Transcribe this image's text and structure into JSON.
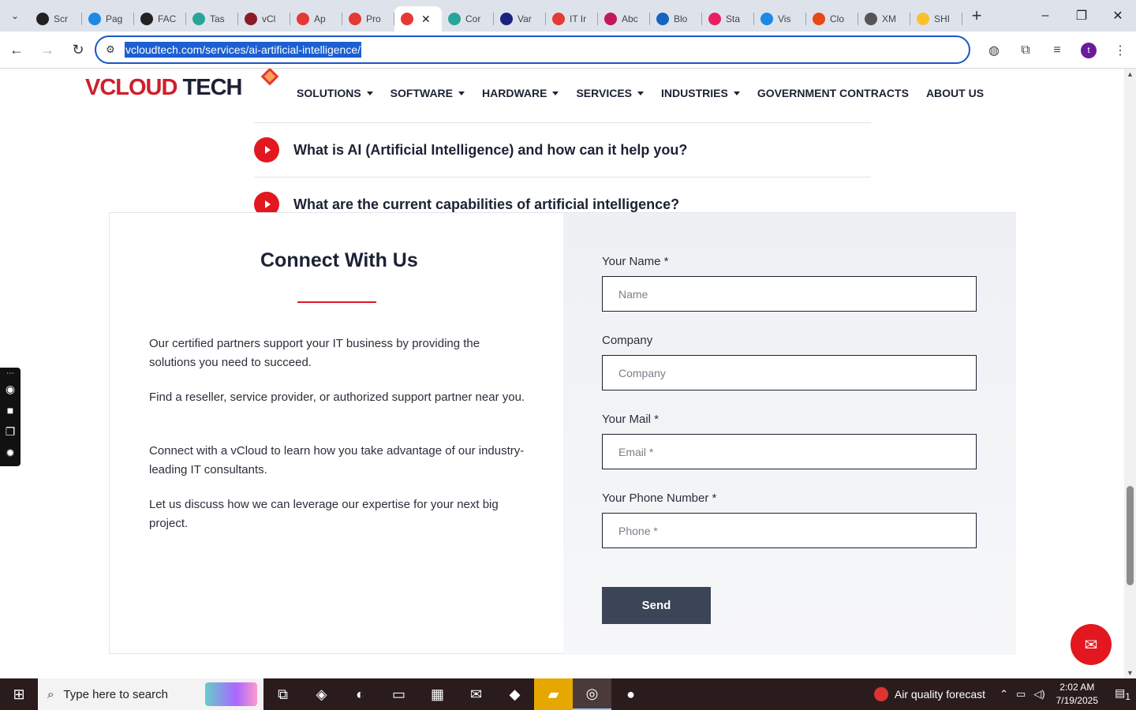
{
  "browser": {
    "tabs": [
      {
        "title": "Scr",
        "color": "#222222"
      },
      {
        "title": "Pag",
        "color": "#1e88e5"
      },
      {
        "title": "FAC",
        "color": "#222222"
      },
      {
        "title": "Tas",
        "color": "#26a69a"
      },
      {
        "title": "vCl",
        "color": "#8b1a2b"
      },
      {
        "title": "Ap",
        "color": "#e53935"
      },
      {
        "title": "Pro",
        "color": "#e53935"
      },
      {
        "title": "",
        "color": "#e53935",
        "active": true
      },
      {
        "title": "Cor",
        "color": "#26a69a"
      },
      {
        "title": "Var",
        "color": "#1a237e"
      },
      {
        "title": "IT Ir",
        "color": "#e53935"
      },
      {
        "title": "Abc",
        "color": "#c2185b"
      },
      {
        "title": "Blo",
        "color": "#1565c0"
      },
      {
        "title": "Sta",
        "color": "#e91e63"
      },
      {
        "title": "Vis",
        "color": "#1e88e5"
      },
      {
        "title": "Clo",
        "color": "#e64a19"
      },
      {
        "title": "XM",
        "color": "#555555"
      },
      {
        "title": "SHI",
        "color": "#fbc02d"
      }
    ],
    "url": "vcloudtech.com/services/ai-artificial-intelligence/",
    "profile_initial": "t"
  },
  "site": {
    "logo_main": "VCLOUD",
    "logo_tech": " TECH",
    "nav": [
      {
        "label": "SOLUTIONS",
        "dropdown": true
      },
      {
        "label": "SOFTWARE",
        "dropdown": true
      },
      {
        "label": "HARDWARE",
        "dropdown": true
      },
      {
        "label": "SERVICES",
        "dropdown": true
      },
      {
        "label": "INDUSTRIES",
        "dropdown": true
      },
      {
        "label": "GOVERNMENT CONTRACTS",
        "dropdown": false
      },
      {
        "label": "ABOUT US",
        "dropdown": false
      }
    ]
  },
  "faq": [
    "What is AI (Artificial Intelligence) and how can it help you?",
    "What are the current capabilities of artificial intelligence?"
  ],
  "connect": {
    "title": "Connect With Us",
    "paragraphs": [
      "Our certified partners support your IT business by providing the solutions you need to succeed.",
      "Find a reseller, service provider, or authorized support partner near you.",
      "Connect with a vCloud to learn how you take advantage of our industry-leading IT consultants.",
      "Let us discuss how we can leverage our expertise for your next big project."
    ],
    "form": {
      "name_label": "Your Name *",
      "name_placeholder": "Name",
      "company_label": "Company",
      "company_placeholder": "Company",
      "mail_label": "Your Mail *",
      "mail_placeholder": "Email *",
      "phone_label": "Your Phone Number *",
      "phone_placeholder": "Phone *",
      "send_label": "Send"
    }
  },
  "taskbar": {
    "search_placeholder": "Type here to search",
    "weather": "Air quality forecast",
    "time": "2:02 AM",
    "date": "7/19/2025",
    "notification_count": "1"
  },
  "colors": {
    "accent": "#e2171f",
    "navy": "#1c2234",
    "button": "#3b4557"
  }
}
